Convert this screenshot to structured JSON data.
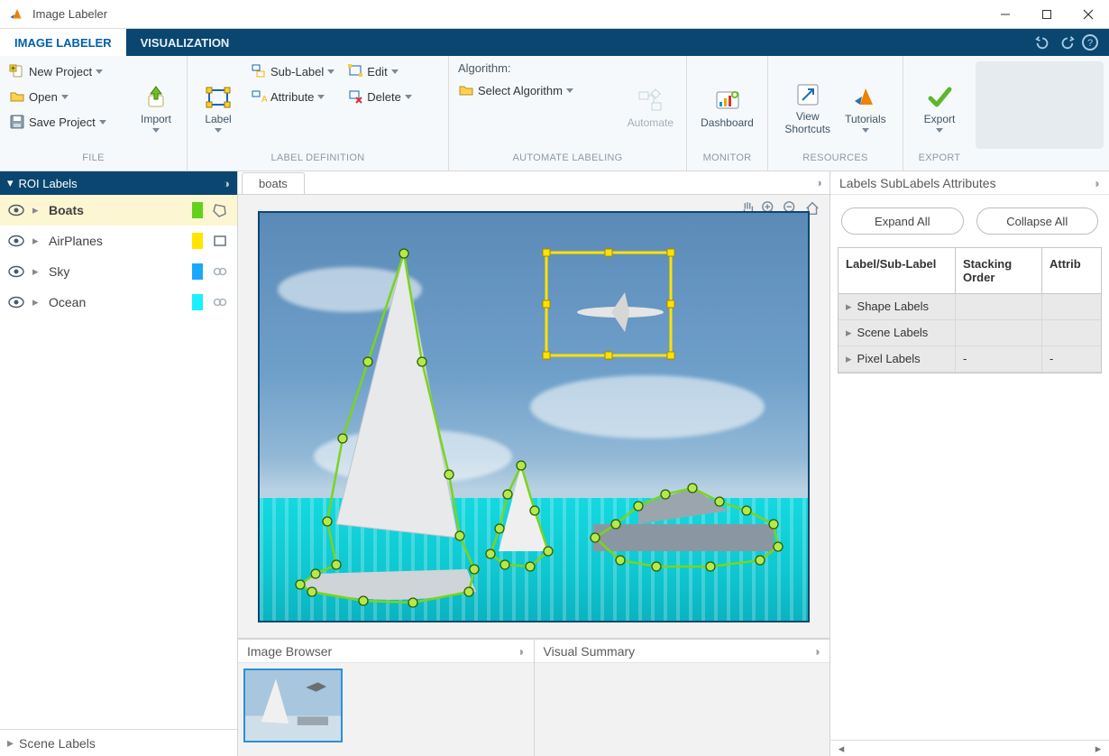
{
  "window": {
    "title": "Image Labeler"
  },
  "tabs": {
    "active": "IMAGE LABELER",
    "other": "VISUALIZATION"
  },
  "ribbon": {
    "file": {
      "caption": "FILE",
      "new_project": "New Project",
      "open": "Open",
      "save_project": "Save Project",
      "import": "Import"
    },
    "labeldef": {
      "caption": "LABEL DEFINITION",
      "label": "Label",
      "sublabel": "Sub-Label",
      "attribute": "Attribute",
      "edit": "Edit",
      "delete": "Delete"
    },
    "automate": {
      "caption": "AUTOMATE LABELING",
      "algorithm_label": "Algorithm:",
      "select_algorithm": "Select Algorithm",
      "automate": "Automate"
    },
    "monitor": {
      "caption": "MONITOR",
      "dashboard": "Dashboard"
    },
    "resources": {
      "caption": "RESOURCES",
      "shortcuts": "View\nShortcuts",
      "tutorials": "Tutorials"
    },
    "export": {
      "caption": "EXPORT",
      "export": "Export"
    }
  },
  "roi": {
    "title": "ROI Labels",
    "items": [
      {
        "name": "Boats",
        "color": "#63d21a",
        "shape": "polygon",
        "selected": true
      },
      {
        "name": "AirPlanes",
        "color": "#ffe500",
        "shape": "rect",
        "selected": false
      },
      {
        "name": "Sky",
        "color": "#1aa8ff",
        "shape": "link",
        "selected": false
      },
      {
        "name": "Ocean",
        "color": "#19f0ff",
        "shape": "link",
        "selected": false
      }
    ]
  },
  "scene_footer": "Scene Labels",
  "image_tab": "boats",
  "bottom": {
    "image_browser": "Image Browser",
    "visual_summary": "Visual Summary"
  },
  "right": {
    "title": "Labels SubLabels Attributes",
    "expand_all": "Expand All",
    "collapse_all": "Collapse All",
    "columns": {
      "c1": "Label/Sub-Label",
      "c2": "Stacking Order",
      "c3": "Attrib"
    },
    "rows": [
      {
        "label": "Shape Labels",
        "order": "",
        "attr": ""
      },
      {
        "label": "Scene Labels",
        "order": "",
        "attr": ""
      },
      {
        "label": "Pixel Labels",
        "order": "-",
        "attr": "-"
      }
    ]
  }
}
